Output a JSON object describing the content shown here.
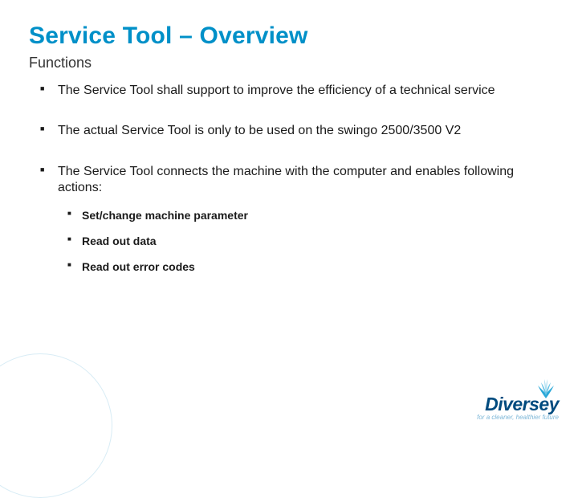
{
  "title": "Service Tool – Overview",
  "subtitle": "Functions",
  "bullets": [
    {
      "text": "The Service Tool shall support to improve the efficiency of a technical service"
    },
    {
      "text": "The actual Service Tool is only to be used on the swingo 2500/3500 V2"
    },
    {
      "text": "The Service Tool connects the machine with the computer and enables following actions:",
      "sub": [
        "Set/change machine parameter",
        "Read out data",
        "Read out error codes"
      ]
    }
  ],
  "logo": {
    "name": "Diversey",
    "tagline": "for a cleaner, healthier future"
  }
}
